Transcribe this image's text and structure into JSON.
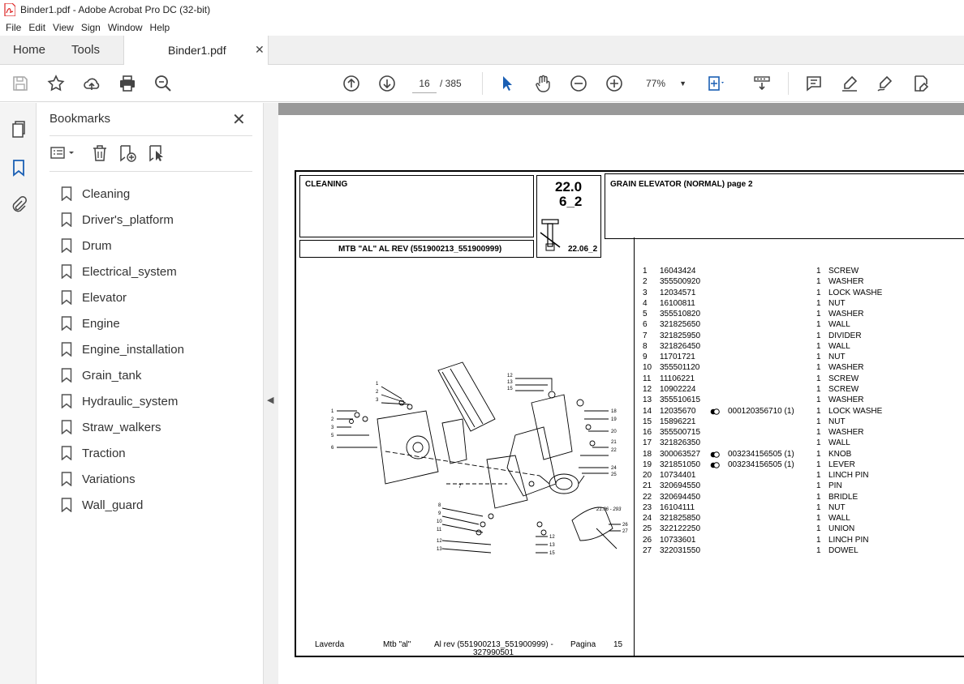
{
  "window": {
    "title": "Binder1.pdf - Adobe Acrobat Pro DC (32-bit)"
  },
  "menu": [
    "File",
    "Edit",
    "View",
    "Sign",
    "Window",
    "Help"
  ],
  "tabs": {
    "home": "Home",
    "tools": "Tools",
    "document": "Binder1.pdf"
  },
  "toolbar": {
    "current_page": "16",
    "page_total": "/ 385",
    "zoom": "77%"
  },
  "bookmarks": {
    "title": "Bookmarks",
    "items": [
      {
        "label": "Cleaning"
      },
      {
        "label": "Driver's_platform"
      },
      {
        "label": "Drum"
      },
      {
        "label": "Electrical_system"
      },
      {
        "label": "Elevator"
      },
      {
        "label": "Engine"
      },
      {
        "label": "Engine_installation"
      },
      {
        "label": "Grain_tank"
      },
      {
        "label": "Hydraulic_system"
      },
      {
        "label": "Straw_walkers"
      },
      {
        "label": "Traction"
      },
      {
        "label": "Variations"
      },
      {
        "label": "Wall_guard"
      }
    ]
  },
  "pdf": {
    "section": "CLEANING",
    "code_line1": "22.0",
    "code_line2": "6_2",
    "code_small": "22.06_2",
    "heading": "GRAIN ELEVATOR (NORMAL) page 2",
    "model": "MTB \"AL\" AL REV (551900213_551900999)",
    "diagram_ref": "21.06 - 293",
    "footer": {
      "brand": "Laverda",
      "model": "Mtb \"al\"",
      "rev": "Al rev (551900213_551900999) -",
      "rev2": "327990501",
      "page_label": "Pagina",
      "page_no": "15"
    },
    "parts": [
      {
        "n": "1",
        "code": "16043424",
        "alt": "",
        "qty": "1",
        "desc": "SCREW"
      },
      {
        "n": "2",
        "code": "355500920",
        "alt": "",
        "qty": "1",
        "desc": "WASHER"
      },
      {
        "n": "3",
        "code": "12034571",
        "alt": "",
        "qty": "1",
        "desc": "LOCK WASHE"
      },
      {
        "n": "4",
        "code": "16100811",
        "alt": "",
        "qty": "1",
        "desc": "NUT"
      },
      {
        "n": "5",
        "code": "355510820",
        "alt": "",
        "qty": "1",
        "desc": "WASHER"
      },
      {
        "n": "6",
        "code": "321825650",
        "alt": "",
        "qty": "1",
        "desc": "WALL"
      },
      {
        "n": "7",
        "code": "321825950",
        "alt": "",
        "qty": "1",
        "desc": "DIVIDER"
      },
      {
        "n": "8",
        "code": "321826450",
        "alt": "",
        "qty": "1",
        "desc": "WALL"
      },
      {
        "n": "9",
        "code": "11701721",
        "alt": "",
        "qty": "1",
        "desc": "NUT"
      },
      {
        "n": "10",
        "code": "355501120",
        "alt": "",
        "qty": "1",
        "desc": "WASHER"
      },
      {
        "n": "11",
        "code": "11106221",
        "alt": "",
        "qty": "1",
        "desc": "SCREW"
      },
      {
        "n": "12",
        "code": "10902224",
        "alt": "",
        "qty": "1",
        "desc": "SCREW"
      },
      {
        "n": "13",
        "code": "355510615",
        "alt": "",
        "qty": "1",
        "desc": "WASHER"
      },
      {
        "n": "14",
        "code": "12035670",
        "alt": "000120356710  (1)",
        "qty": "1",
        "desc": "LOCK WASHE"
      },
      {
        "n": "15",
        "code": "15896221",
        "alt": "",
        "qty": "1",
        "desc": "NUT"
      },
      {
        "n": "16",
        "code": "355500715",
        "alt": "",
        "qty": "1",
        "desc": "WASHER"
      },
      {
        "n": "17",
        "code": "321826350",
        "alt": "",
        "qty": "1",
        "desc": "WALL"
      },
      {
        "n": "18",
        "code": "300063527",
        "alt": "003234156505  (1)",
        "qty": "1",
        "desc": "KNOB"
      },
      {
        "n": "19",
        "code": "321851050",
        "alt": "003234156505  (1)",
        "qty": "1",
        "desc": "LEVER"
      },
      {
        "n": "20",
        "code": "10734401",
        "alt": "",
        "qty": "1",
        "desc": "LINCH PIN"
      },
      {
        "n": "21",
        "code": "320694550",
        "alt": "",
        "qty": "1",
        "desc": "PIN"
      },
      {
        "n": "22",
        "code": "320694450",
        "alt": "",
        "qty": "1",
        "desc": "BRIDLE"
      },
      {
        "n": "23",
        "code": "16104111",
        "alt": "",
        "qty": "1",
        "desc": "NUT"
      },
      {
        "n": "24",
        "code": "321825850",
        "alt": "",
        "qty": "1",
        "desc": "WALL"
      },
      {
        "n": "25",
        "code": "322122250",
        "alt": "",
        "qty": "1",
        "desc": "UNION"
      },
      {
        "n": "26",
        "code": "10733601",
        "alt": "",
        "qty": "1",
        "desc": "LINCH PIN"
      },
      {
        "n": "27",
        "code": "322031550",
        "alt": "",
        "qty": "1",
        "desc": "DOWEL"
      }
    ]
  }
}
